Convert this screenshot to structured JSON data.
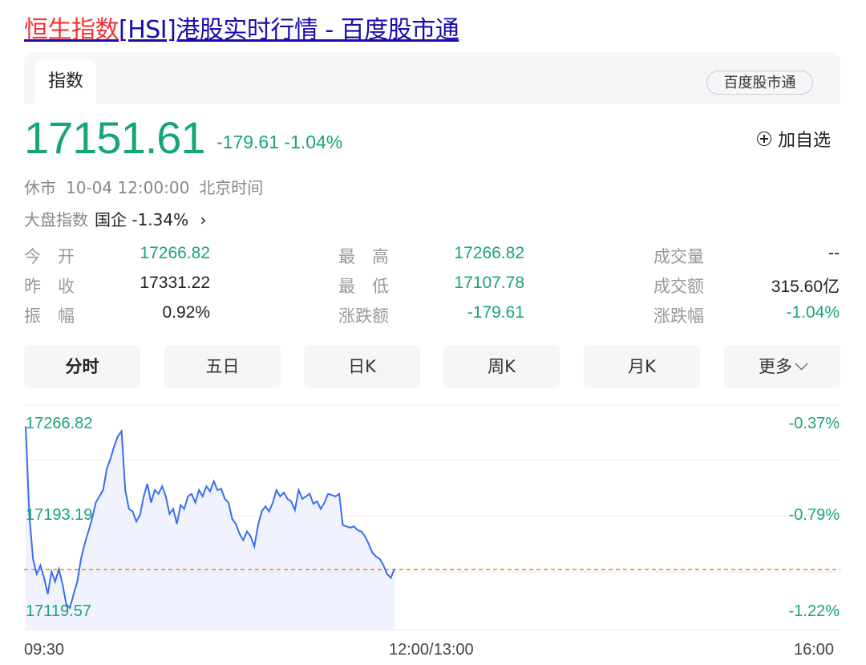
{
  "title": {
    "highlight": "恒生指数",
    "rest": "[HSI]港股实时行情 - 百度股市通"
  },
  "tabs": {
    "active": "指数",
    "brand": "百度股市通"
  },
  "quote": {
    "price": "17151.61",
    "change": "-179.61",
    "change_pct": "-1.04%",
    "add_watch": "加自选"
  },
  "status": {
    "state": "休市",
    "datetime": "10-04 12:00:00",
    "timezone": "北京时间"
  },
  "market": {
    "label": "大盘指数",
    "index_text": "国企 -1.34%",
    "arrow": "›"
  },
  "stats": [
    {
      "label": "今　开",
      "value": "17266.82",
      "color": "green"
    },
    {
      "label": "最　高",
      "value": "17266.82",
      "color": "green"
    },
    {
      "label": "成交量",
      "value": "--",
      "color": "dark"
    },
    {
      "label": "昨　收",
      "value": "17331.22",
      "color": "dark"
    },
    {
      "label": "最　低",
      "value": "17107.78",
      "color": "green"
    },
    {
      "label": "成交额",
      "value": "315.60亿",
      "color": "dark"
    },
    {
      "label": "振　幅",
      "value": "0.92%",
      "color": "dark"
    },
    {
      "label": "涨跌额",
      "value": "-179.61",
      "color": "green"
    },
    {
      "label": "涨跌幅",
      "value": "-1.04%",
      "color": "green"
    }
  ],
  "periods": [
    "分时",
    "五日",
    "日K",
    "周K",
    "月K",
    "更多"
  ],
  "chart_data": {
    "type": "line",
    "y_left_labels": [
      "17266.82",
      "17193.19",
      "17119.57"
    ],
    "y_right_labels": [
      "-0.37%",
      "-0.79%",
      "-1.22%"
    ],
    "x_labels": [
      "09:30",
      "12:00/13:00",
      "16:00"
    ],
    "ylim": [
      17119.57,
      17266.82
    ],
    "reference_value": 17151.61,
    "series": [
      {
        "values": [
          17266.0,
          17195.0,
          17160.0,
          17148.0,
          17155.0,
          17145.0,
          17132.0,
          17150.0,
          17142.0,
          17152.0,
          17140.0,
          17124.0,
          17121.0,
          17132.0,
          17142.0,
          17160.0,
          17172.0,
          17182.0,
          17192.0,
          17205.0,
          17210.0,
          17215.0,
          17232.0,
          17240.0,
          17250.0,
          17258.0,
          17262.0,
          17215.0,
          17200.0,
          17198.0,
          17190.0,
          17195.0,
          17210.0,
          17220.0,
          17205.0,
          17215.0,
          17212.0,
          17218.0,
          17210.0,
          17196.0,
          17200.0,
          17188.0,
          17203.0,
          17200.0,
          17210.0,
          17212.0,
          17205.0,
          17215.0,
          17210.0,
          17218.0,
          17214.0,
          17222.0,
          17215.0,
          17216.0,
          17208.0,
          17205.0,
          17192.0,
          17188.0,
          17180.0,
          17175.0,
          17182.0,
          17178.0,
          17170.0,
          17187.0,
          17198.0,
          17202.0,
          17198.0,
          17205.0,
          17215.0,
          17210.0,
          17213.0,
          17208.0,
          17206.0,
          17199.0,
          17215.0,
          17208.0,
          17210.0,
          17212.0,
          17204.0,
          17206.0,
          17200.0,
          17205.0,
          17212.0,
          17211.0,
          17210.0,
          17212.0,
          17187.0,
          17186.0,
          17185.0,
          17186.0,
          17183.0,
          17182.0,
          17178.0,
          17172.0,
          17165.0,
          17162.0,
          17160.0,
          17155.0,
          17148.0,
          17145.0,
          17152.0
        ],
        "color": "#3a6df0"
      }
    ],
    "colors": {
      "line": "#3a6df0",
      "reference": "#f08a24",
      "grid": "#eeeeee"
    }
  }
}
